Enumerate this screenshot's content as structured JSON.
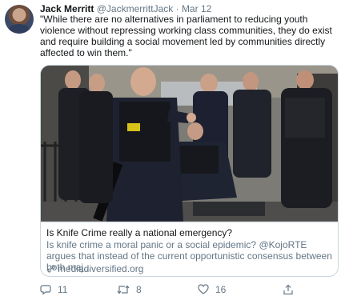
{
  "tweet": {
    "author_name": "Jack Merritt",
    "author_handle": "@JackmerrittJack",
    "separator": "·",
    "date": "Mar 12",
    "text": "\"While there are no alternatives in parliament to reducing youth violence without repressing working class communities, they do exist and require building a social movement led by communities directly affected to win them.\""
  },
  "card": {
    "title": "Is Knife Crime really a national emergency?",
    "description": "Is knife crime a moral panic or a social epidemic? @KojoRTE argues that instead of the current opportunistic consensus between both maj...",
    "domain": "mediadiversified.org",
    "image_icon": "police-officers-photo",
    "link_icon": "link-icon"
  },
  "actions": {
    "reply_count": "11",
    "retweet_count": "8",
    "like_count": "16",
    "reply_icon": "reply-icon",
    "retweet_icon": "retweet-icon",
    "like_icon": "heart-icon",
    "share_icon": "share-icon"
  },
  "colors": {
    "text": "#14171a",
    "secondary": "#657786",
    "border": "#ccd6dd"
  }
}
